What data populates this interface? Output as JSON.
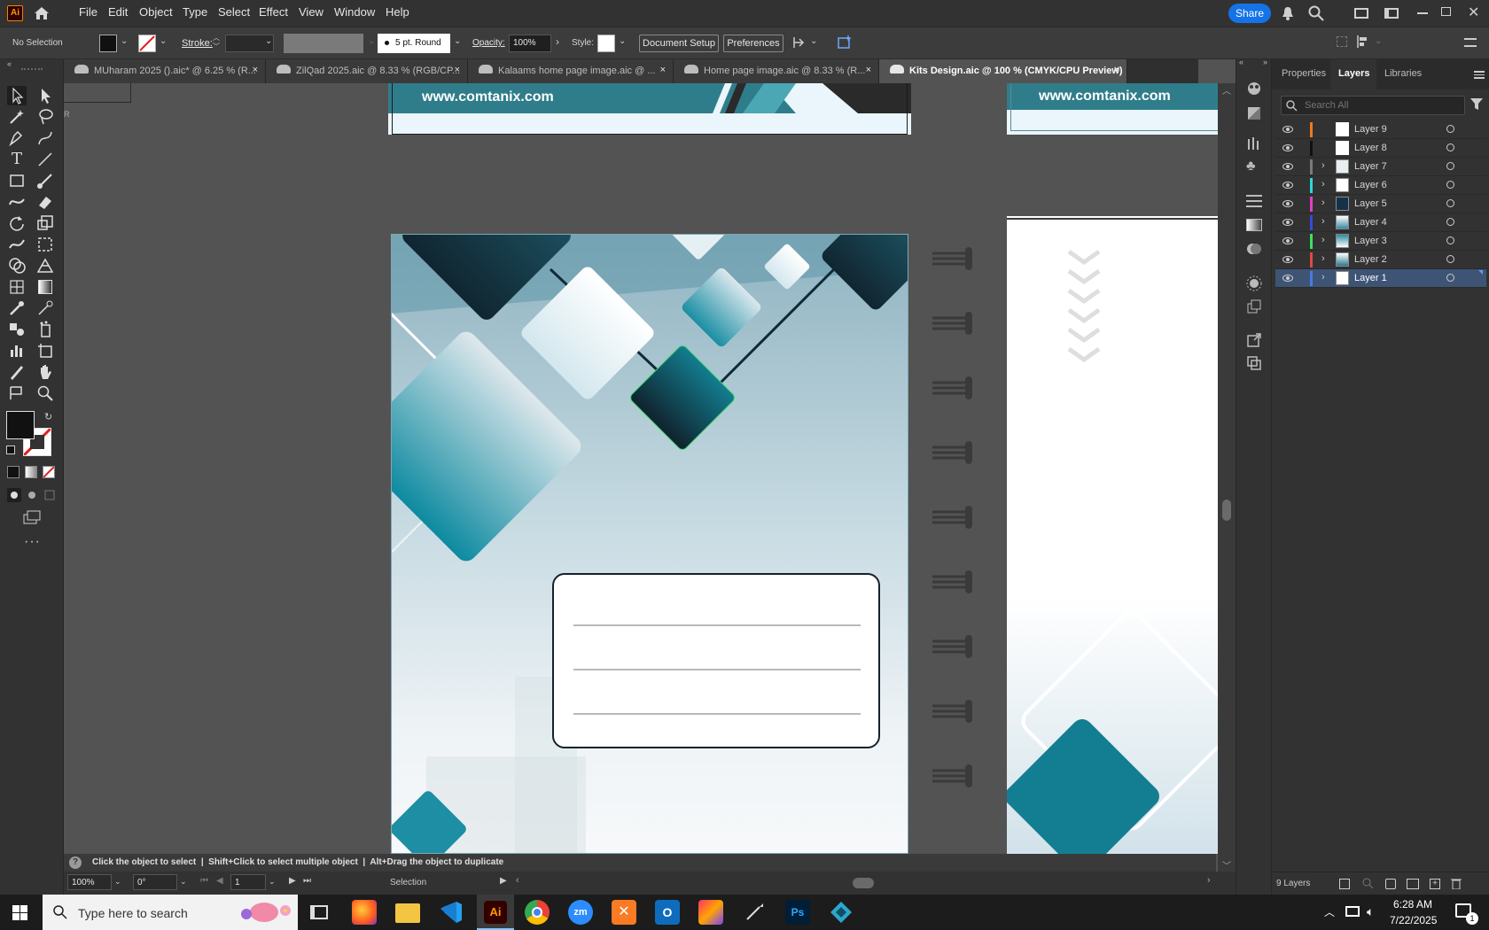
{
  "app": {
    "logo": "Ai"
  },
  "menu": [
    "File",
    "Edit",
    "Object",
    "Type",
    "Select",
    "Effect",
    "View",
    "Window",
    "Help"
  ],
  "top_right": {
    "share_label": "Share"
  },
  "control": {
    "selection_state": "No Selection",
    "stroke_label": "Stroke:",
    "brush_value": "5 pt. Round",
    "opacity_label": "Opacity:",
    "opacity_value": "100%",
    "style_label": "Style:",
    "document_setup": "Document Setup",
    "preferences": "Preferences"
  },
  "tabs": [
    {
      "label": "MUharam 2025 ().aic* @ 6.25 % (R...",
      "close": "×"
    },
    {
      "label": "ZilQad 2025.aic @ 8.33 % (RGB/CP...",
      "close": "×"
    },
    {
      "label": "Kalaams home page image.aic @ ...",
      "close": "×"
    },
    {
      "label": "Home page image.aic @ 8.33 % (R...",
      "close": "×"
    },
    {
      "label": "Kits Design.aic @ 100 % (CMYK/CPU Preview)",
      "close": "×"
    }
  ],
  "artwork": {
    "url_left": "www.comtanix.com",
    "url_right": "www.comtanix.com",
    "accent": "#2f7d8a",
    "dark": "#163845"
  },
  "panel": {
    "tabs": [
      "Properties",
      "Layers",
      "Libraries"
    ],
    "active_tab": "Layers",
    "search_placeholder": "Search All",
    "layers": [
      {
        "name": "Layer 9",
        "color": "#f07a1a",
        "expandable": false
      },
      {
        "name": "Layer 8",
        "color": "#111111",
        "expandable": false
      },
      {
        "name": "Layer 7",
        "color": "#7a7a7a",
        "expandable": true
      },
      {
        "name": "Layer 6",
        "color": "#2fd6d6",
        "expandable": true
      },
      {
        "name": "Layer 5",
        "color": "#e040c8",
        "expandable": true
      },
      {
        "name": "Layer 4",
        "color": "#3a4ad6",
        "expandable": true
      },
      {
        "name": "Layer 3",
        "color": "#3ee05a",
        "expandable": true
      },
      {
        "name": "Layer 2",
        "color": "#e04848",
        "expandable": true
      },
      {
        "name": "Layer 1",
        "color": "#4a7ae0",
        "expandable": true
      }
    ],
    "layer_count": "9 Layers"
  },
  "status": {
    "hint": "Click the object to select  |  Shift+Click to select multiple object  |  Alt+Drag the object to duplicate"
  },
  "bottom": {
    "zoom": "100%",
    "rotation": "0°",
    "artboard": "1",
    "tool": "Selection"
  },
  "taskbar": {
    "search_placeholder": "Type here to search",
    "time": "6:28 AM",
    "date": "7/22/2025",
    "notification_count": "1"
  }
}
